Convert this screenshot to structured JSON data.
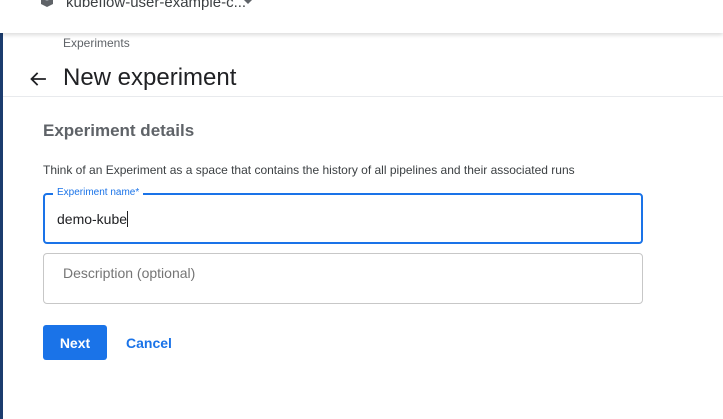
{
  "header": {
    "namespace_label": "kubeflow-user-example-c...",
    "namespace_icon": "cube-icon",
    "dropdown_icon": "caret-down-icon"
  },
  "breadcrumb": "Experiments",
  "back_icon": "arrow-left-icon",
  "page_title": "New experiment",
  "section": {
    "title": "Experiment details",
    "description": "Think of an Experiment as a space that contains the history of all pipelines and their associated runs"
  },
  "form": {
    "name_label": "Experiment name*",
    "name_value": "demo-kube",
    "description_placeholder": "Description (optional)"
  },
  "buttons": {
    "next": "Next",
    "cancel": "Cancel"
  },
  "colors": {
    "primary": "#1a73e8",
    "sidebar_edge": "#1b3c6e"
  }
}
